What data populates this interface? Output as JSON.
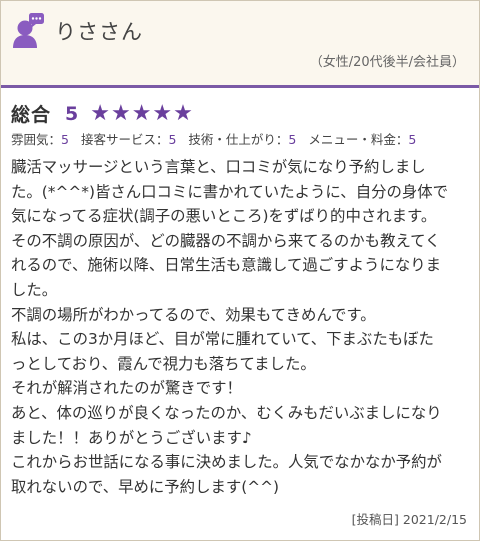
{
  "reviewer": {
    "name": "りささん",
    "profile": "（女性/20代後半/会社員）",
    "avatar_icon": "user-chat-icon"
  },
  "rating": {
    "overall_label": "総合",
    "overall_score": "5",
    "stars": "★★★★★",
    "star_color": "#6a3f9d",
    "subs": [
      {
        "label": "雰囲気：",
        "value": "5"
      },
      {
        "label": "接客サービス：",
        "value": "5"
      },
      {
        "label": "技術・仕上がり：",
        "value": "5"
      },
      {
        "label": "メニュー・料金：",
        "value": "5"
      }
    ]
  },
  "review_lines": [
    "臓活マッサージという言葉と、口コミが気になり予約しまし",
    "た。(*^^*)皆さん口コミに書かれていたように、自分の身体で",
    "気になってる症状(調子の悪いところ)をずばり的中されます。",
    "その不調の原因が、どの臓器の不調から来てるのかも教えてく",
    "れるので、施術以降、日常生活も意識して過ごすようになりま",
    "した。",
    "不調の場所がわかってるので、効果もてきめんです。",
    "私は、この3か月ほど、目が常に腫れていて、下まぶたもぼた",
    "っとしており、霞んで視力も落ちてました。",
    "それが解消されたのが驚きです！",
    "あと、体の巡りが良くなったのか、むくみもだいぶましになり",
    "ました！！ありがとうございます♪",
    "これからお世話になる事に決めました。人気でなかなか予約が",
    "取れないので、早めに予約します(^^)"
  ],
  "posted": "[投稿日] 2021/2/15",
  "colors": {
    "accent": "#6a3f9d",
    "header_bg": "#fbf7ee",
    "border": "#7b5aa6"
  }
}
